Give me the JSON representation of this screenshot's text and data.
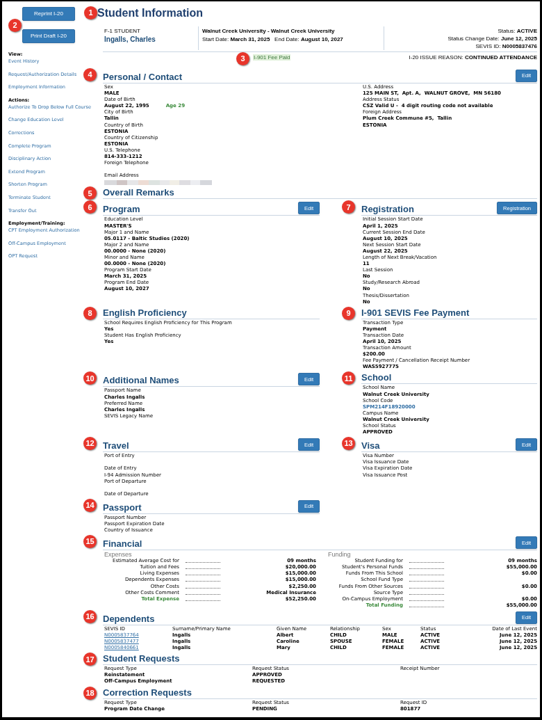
{
  "buttons": {
    "callout": "2",
    "items": [
      "Reprint I-20",
      "Print Draft I-20"
    ]
  },
  "sidebar": [
    {
      "heading": "View:",
      "links": [
        "Event History",
        "Request/Authorization Details",
        "Employment Information"
      ]
    },
    {
      "heading": "Actions:",
      "links": [
        "Authorize To Drop Below Full Course",
        "Change Education Level",
        "Corrections",
        "Complete Program",
        "Disciplinary Action",
        "Extend Program",
        "Shorten Program",
        "Terminate Student",
        "Transfer Out"
      ]
    },
    {
      "heading": "Employment/Training:",
      "links": [
        "CPT Employment Authorization",
        "Off-Campus Employment",
        "OPT Request"
      ]
    }
  ],
  "header": {
    "title": "Student Information",
    "callout": "1"
  },
  "summary": {
    "visa_type": "F-1 STUDENT",
    "name": "Ingalls, Charles",
    "school": "Walnut Creek University - Walnut Creek University",
    "start_label": "Start Date:",
    "start": "March 31, 2025",
    "end_label": "End Date:",
    "end": "August 10, 2027",
    "status_label": "Status:",
    "status": "ACTIVE",
    "status_change_label": "Status Change Date:",
    "status_change": "June 12, 2025",
    "sevis_label": "SEVIS ID:",
    "sevis": "N0005837476"
  },
  "fee": {
    "badge": "I-901 Fee Paid",
    "callout": "3",
    "reason_label": "I-20 ISSUE REASON:",
    "reason": "CONTINUED ATTENDANCE"
  },
  "rows": [
    [
      {
        "kind": "split",
        "title": "Personal / Contact",
        "callout": "4",
        "button": "Edit",
        "left_fields": [
          {
            "label": "Sex",
            "value": "MALE"
          },
          {
            "label": "Date of Birth",
            "value": "August 22, 1995",
            "note": "Age 29"
          },
          {
            "label": "City of Birth",
            "value": "Tallin"
          },
          {
            "label": "Country of Birth",
            "value": "ESTONIA"
          },
          {
            "label": "Country of Citizenship",
            "value": "ESTONIA"
          },
          {
            "label": "U.S. Telephone",
            "value": "814-333-1212"
          },
          {
            "label": "Foreign Telephone",
            "blank": true
          },
          {
            "label": "Email Address",
            "redacted": true
          }
        ],
        "right_fields": [
          {
            "label": "U.S. Address",
            "value": "125 MAIN ST,  Apt. A,  WALNUT GROVE,  MN 56180"
          },
          {
            "label": "Address Status",
            "value": "CSZ Valid U -  4 digit routing code not available"
          },
          {
            "label": "Foreign Address",
            "value": "Plum Creek Commune #5,  Tallin"
          },
          {
            "value": "ESTONIA"
          }
        ]
      }
    ],
    [
      {
        "kind": "empty",
        "title": "Overall Remarks",
        "callout": "5"
      }
    ],
    [
      {
        "kind": "fields",
        "title": "Program",
        "callout": "6",
        "button": "Edit",
        "fields": [
          {
            "label": "Education Level",
            "value": "MASTER'S"
          },
          {
            "label": "Major 1 and Name",
            "value": "05.0117 - Baltic Studies (2020)"
          },
          {
            "label": "Major 2 and Name",
            "value": "00.0000 - None (2020)"
          },
          {
            "label": "Minor and Name",
            "value": "00.0000 - None (2020)"
          },
          {
            "label": "Program Start Date",
            "value": "March 31, 2025"
          },
          {
            "label": "Program End Date",
            "value": "August 10, 2027"
          }
        ]
      },
      {
        "kind": "fields",
        "title": "Registration",
        "callout": "7",
        "button": "Registration",
        "fields": [
          {
            "label": "Initial Session Start Date",
            "value": "April 1, 2025"
          },
          {
            "label": "Current Session End Date",
            "value": "August 10, 2025"
          },
          {
            "label": "Next Session Start Date",
            "value": "August 22, 2025"
          },
          {
            "label": "Length of Next Break/Vacation",
            "value": "11"
          },
          {
            "label": "Last Session",
            "value": "No"
          },
          {
            "label": "Study/Research Abroad",
            "value": "No"
          },
          {
            "label": "Thesis/Dissertation",
            "value": "No"
          }
        ]
      }
    ],
    [
      {
        "kind": "fields",
        "title": "English Proficiency",
        "callout": "8",
        "fields": [
          {
            "label": "School Requires English Proficiency for This Program",
            "value": "Yes"
          },
          {
            "label": "Student Has English Proficiency",
            "value": "Yes"
          }
        ]
      },
      {
        "kind": "fields",
        "title": "I-901 SEVIS Fee Payment",
        "callout": "9",
        "fields": [
          {
            "label": "Transaction Type",
            "value": "Payment"
          },
          {
            "label": "Transaction Date",
            "value": "April 10, 2025"
          },
          {
            "label": "Transaction Amount",
            "value": "$200.00"
          },
          {
            "label": "Fee Payment / Cancellation Receipt Number",
            "value": "WAS5927775"
          }
        ]
      }
    ],
    [
      {
        "kind": "fields",
        "title": "Additional Names",
        "callout": "10",
        "button": "Edit",
        "fields": [
          {
            "label": "Passport Name",
            "value": "Charles Ingalls"
          },
          {
            "label": "Preferred Name",
            "value": "Charles Ingalls"
          },
          {
            "label": "SEVIS Legacy Name"
          }
        ]
      },
      {
        "kind": "fields",
        "title": "School",
        "callout": "11",
        "fields": [
          {
            "label": "School Name",
            "value": "Walnut Creek University"
          },
          {
            "label": "School Code",
            "value": "SPM214F18920000",
            "link": true
          },
          {
            "label": "Campus Name",
            "value": "Walnut Creek University"
          },
          {
            "label": "School Status",
            "value": "APPROVED"
          }
        ]
      }
    ],
    [
      {
        "kind": "fields",
        "title": "Travel",
        "callout": "12",
        "button": "Edit",
        "fields": [
          {
            "label": "Port of Entry",
            "blank": true
          },
          {
            "label": "Date of Entry"
          },
          {
            "label": "I-94 Admission Number"
          },
          {
            "label": "Port of Departure",
            "blank": true
          },
          {
            "label": "Date of Departure"
          }
        ]
      },
      {
        "kind": "fields",
        "title": "Visa",
        "callout": "13",
        "button": "Edit",
        "fields": [
          {
            "label": "Visa Number"
          },
          {
            "label": "Visa Issuance Date"
          },
          {
            "label": "Visa Expiration Date"
          },
          {
            "label": "Visa Issuance Post"
          }
        ]
      }
    ],
    [
      {
        "kind": "fields",
        "title": "Passport",
        "callout": "14",
        "button": "Edit",
        "fields": [
          {
            "label": "Passport Number"
          },
          {
            "label": "Passport Expiration Date"
          },
          {
            "label": "Country of Issuance"
          }
        ]
      }
    ],
    [
      {
        "kind": "financial",
        "title": "Financial",
        "callout": "15",
        "button": "Edit",
        "expenses": {
          "title": "Expenses",
          "rows": [
            {
              "label": "Estimated Average Cost for",
              "value": "09 months",
              "total": false
            },
            {
              "label": "Tuition and Fees",
              "value": "$20,000.00",
              "total": false
            },
            {
              "label": "Living Expenses",
              "value": "$15,000.00",
              "total": false
            },
            {
              "label": "Dependents Expenses",
              "value": "$15,000.00",
              "total": false
            },
            {
              "label": "Other Costs",
              "value": "$2,250.00",
              "total": false
            },
            {
              "label": "Other Costs Comment",
              "value": "Medical Insurance",
              "total": false
            },
            {
              "label": "Total Expense",
              "value": "$52,250.00",
              "total": true
            }
          ]
        },
        "funding": {
          "title": "Funding",
          "rows": [
            {
              "label": "Student Funding for",
              "value": "09 months",
              "total": false
            },
            {
              "label": "Student's Personal Funds",
              "value": "$55,000.00",
              "total": false
            },
            {
              "label": "Funds From This School",
              "value": "$0.00",
              "total": false
            },
            {
              "label": "School Fund Type",
              "total": false
            },
            {
              "label": "Funds From Other Sources",
              "value": "$0.00",
              "total": false
            },
            {
              "label": "Source Type",
              "total": false
            },
            {
              "label": "On-Campus Employment",
              "value": "$0.00",
              "total": false
            },
            {
              "label": "Total Funding",
              "value": "$55,000.00",
              "total": true
            }
          ]
        }
      }
    ],
    [
      {
        "kind": "dependents_table",
        "title": "Dependents",
        "callout": "16",
        "button": "Edit",
        "first_column_links": true,
        "columns": [
          "SEVIS ID",
          "Surname/Primary Name",
          "Given Name",
          "Relationship",
          "Sex",
          "Status",
          "Date of Last Event"
        ],
        "rows": [
          [
            "N0005837764",
            "Ingalls",
            "Albert",
            "CHILD",
            "MALE",
            "ACTIVE",
            "June 12, 2025"
          ],
          [
            "N0005837477",
            "Ingalls",
            "Caroline",
            "SPOUSE",
            "FEMALE",
            "ACTIVE",
            "June 12, 2025"
          ],
          [
            "N0005840661",
            "Ingalls",
            "Mary",
            "CHILD",
            "FEMALE",
            "ACTIVE",
            "June 12, 2025"
          ]
        ]
      }
    ],
    [
      {
        "kind": "requests_table",
        "title": "Student Requests",
        "callout": "17",
        "first_column_links": false,
        "columns": [
          "Request Type",
          "Request Status",
          "Receipt Number"
        ],
        "rows": [
          [
            "Reinstatement",
            "APPROVED"
          ],
          [
            "Off-Campus Employment",
            "REQUESTED"
          ]
        ]
      }
    ],
    [
      {
        "kind": "requests_table",
        "title": "Correction Requests",
        "callout": "18",
        "first_column_links": false,
        "columns": [
          "Request Type",
          "Request Status",
          "Request ID"
        ],
        "rows": [
          [
            "Program Date Change",
            "PENDING",
            "801877"
          ]
        ]
      }
    ]
  ]
}
